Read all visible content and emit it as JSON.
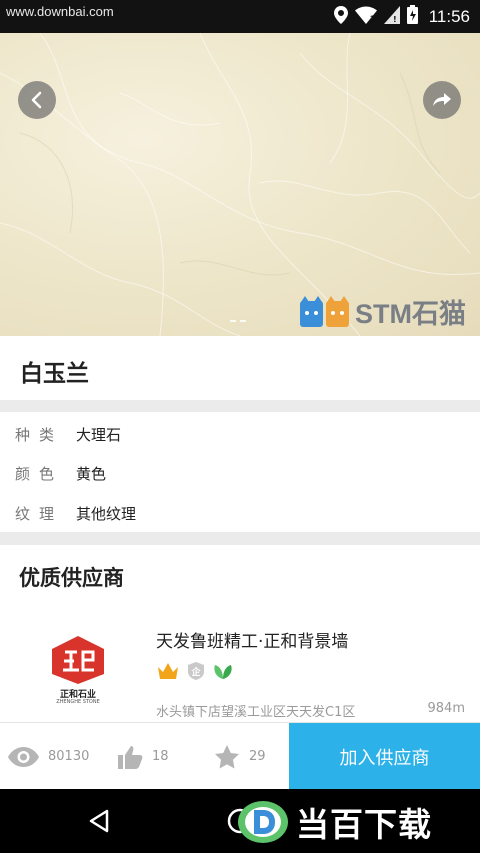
{
  "status_bar": {
    "watermark_url": "www.downbai.com",
    "time": "11:56",
    "icons": [
      "location-icon",
      "wifi-icon",
      "signal-icon",
      "battery-icon"
    ]
  },
  "hero": {
    "logo_text": "STM石猫",
    "colors": {
      "marble": "#ede5c8",
      "button_bg": "#6e6e6e"
    }
  },
  "product": {
    "title": "白玉兰"
  },
  "attributes": [
    {
      "label": "种类",
      "value": "大理石"
    },
    {
      "label": "颜色",
      "value": "黄色"
    },
    {
      "label": "纹理",
      "value": "其他纹理"
    }
  ],
  "supplier_section": {
    "title": "优质供应商",
    "supplier": {
      "logo_text": "正和石业",
      "logo_subtext": "ZHENGHE STONE",
      "name": "天发鲁班精工·正和背景墙",
      "badges": [
        "crown-badge-icon",
        "certified-badge-icon",
        "leaf-badge-icon"
      ],
      "address": "水头镇下店望溪工业区天天发C1区",
      "distance": "984m",
      "logo_color": "#d9342b"
    }
  },
  "action_bar": {
    "views": "80130",
    "likes": "18",
    "favorites": "29",
    "join_label": "加入供应商",
    "accent_color": "#2cb2e8"
  },
  "nav_bar": {
    "brand_watermark": "当百下载"
  }
}
